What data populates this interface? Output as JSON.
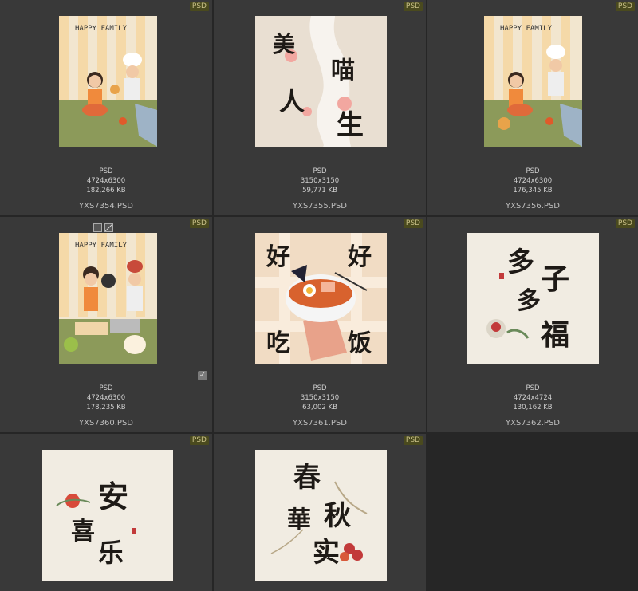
{
  "badge_label": "PSD",
  "items": [
    {
      "name": "YXS7354.PSD",
      "type": "PSD",
      "dims": "4724x6300",
      "size": "182,266 KB",
      "art": "HAPPY FAMILY"
    },
    {
      "name": "YXS7355.PSD",
      "type": "PSD",
      "dims": "3150x3150",
      "size": "59,771 KB",
      "art_chars": [
        "美",
        "喵",
        "人",
        "生"
      ]
    },
    {
      "name": "YXS7356.PSD",
      "type": "PSD",
      "dims": "4724x6300",
      "size": "176,345 KB",
      "art": "HAPPY FAMILY"
    },
    {
      "name": "YXS7360.PSD",
      "type": "PSD",
      "dims": "4724x6300",
      "size": "178,235 KB",
      "art": "HAPPY FAMILY",
      "selected": true
    },
    {
      "name": "YXS7361.PSD",
      "type": "PSD",
      "dims": "3150x3150",
      "size": "63,002 KB",
      "art_chars": [
        "好",
        "好",
        "吃",
        "饭"
      ]
    },
    {
      "name": "YXS7362.PSD",
      "type": "PSD",
      "dims": "4724x4724",
      "size": "130,162 KB",
      "art_chars": [
        "多",
        "子",
        "多",
        "福"
      ]
    },
    {
      "name": "",
      "type": "PSD",
      "art_chars": [
        "安",
        "喜",
        "乐"
      ]
    },
    {
      "name": "",
      "type": "PSD",
      "art_chars": [
        "春",
        "秋",
        "華",
        "实"
      ]
    }
  ],
  "colors": {
    "bg": "#262626",
    "cell": "#393939",
    "badge_bg": "#4a4a1e",
    "badge_text": "#c9c089"
  }
}
